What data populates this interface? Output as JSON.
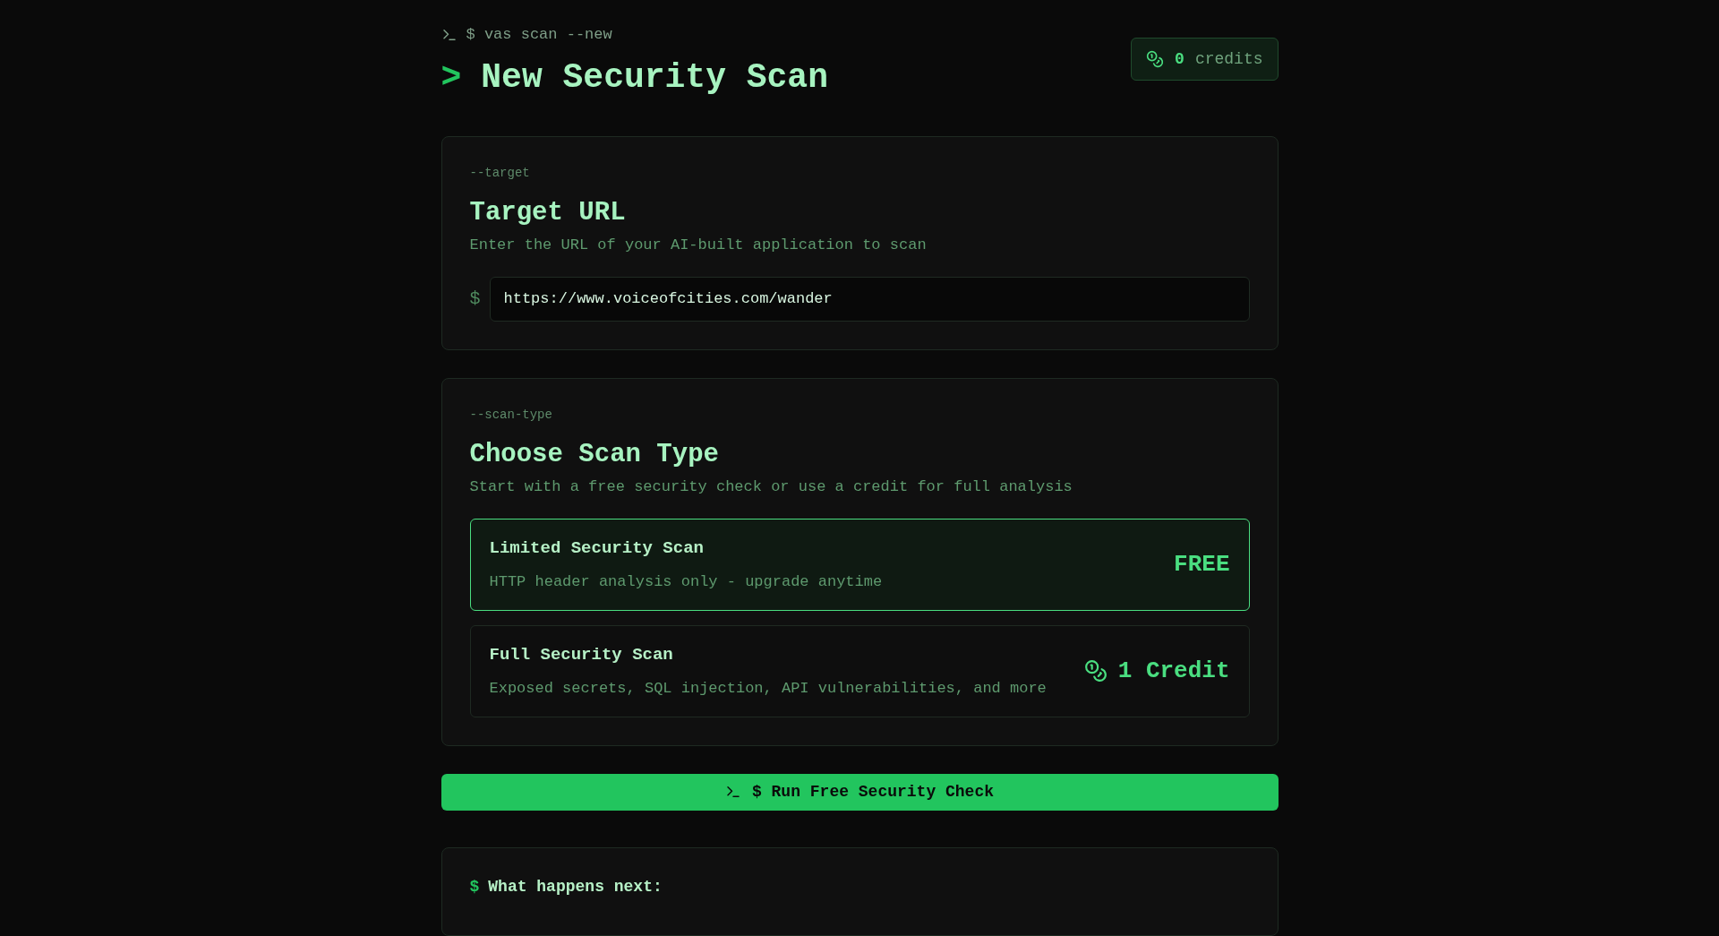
{
  "header": {
    "command": "$ vas scan --new",
    "title_marker": ">",
    "title": "New Security Scan",
    "credits": {
      "count": "0",
      "label": "credits"
    }
  },
  "target": {
    "flag": "--target",
    "title": "Target URL",
    "description": "Enter the URL of your AI-built application to scan",
    "prompt": "$",
    "value": "https://www.voiceofcities.com/wander"
  },
  "scan_type": {
    "flag": "--scan-type",
    "title": "Choose Scan Type",
    "description": "Start with a free security check or use a credit for full analysis",
    "options": [
      {
        "name": "Limited Security Scan",
        "description": "HTTP header analysis only - upgrade anytime",
        "price": "FREE",
        "kind": "free",
        "selected": true
      },
      {
        "name": "Full Security Scan",
        "description": "Exposed secrets, SQL injection, API vulnerabilities, and more",
        "price": "1 Credit",
        "kind": "credit",
        "selected": false
      }
    ]
  },
  "run_button": {
    "label": "$ Run Free Security Check"
  },
  "next": {
    "prompt": "$",
    "title": "What happens next:"
  }
}
